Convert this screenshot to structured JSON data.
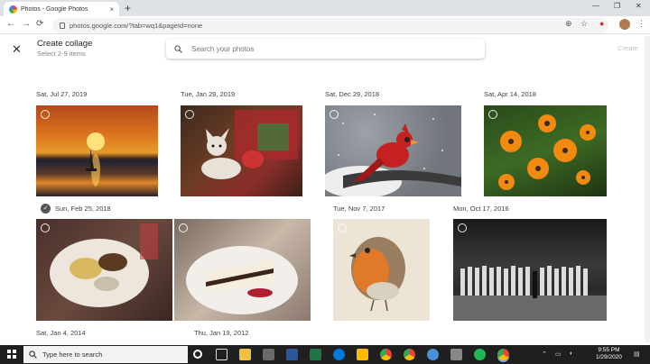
{
  "browser": {
    "tab_title": "Photos - Google Photos",
    "tab_close": "×",
    "new_tab": "+",
    "url": "photos.google.com/?tab=wq1&pageId=none",
    "win_min": "—",
    "win_max": "❐",
    "win_close": "✕",
    "back": "←",
    "forward": "→",
    "reload": "⟳",
    "star": "☆",
    "menu": "⋮"
  },
  "header": {
    "close": "✕",
    "title": "Create collage",
    "subtitle": "Select 2-9 items",
    "search_placeholder": "Search your photos",
    "create_label": "Create"
  },
  "groups": [
    {
      "date": "Sat, Jul 27, 2019"
    },
    {
      "date": "Tue, Jan 29, 2019"
    },
    {
      "date": "Sat, Dec 29, 2018"
    },
    {
      "date": "Sat, Apr 14, 2018"
    },
    {
      "date": "Sun, Feb 25, 2018"
    },
    {
      "date": "Tue, Nov 7, 2017"
    },
    {
      "date": "Mon, Oct 17, 2016"
    },
    {
      "date": "Sat, Jan 4, 2014"
    },
    {
      "date": "Thu, Jan 19, 2012"
    }
  ],
  "taskbar": {
    "search_placeholder": "Type here to search",
    "time": "9:55 PM",
    "date": "1/29/2020"
  },
  "colors": {
    "accent": "#1a73e8",
    "taskbar": "#1f1f1f"
  }
}
